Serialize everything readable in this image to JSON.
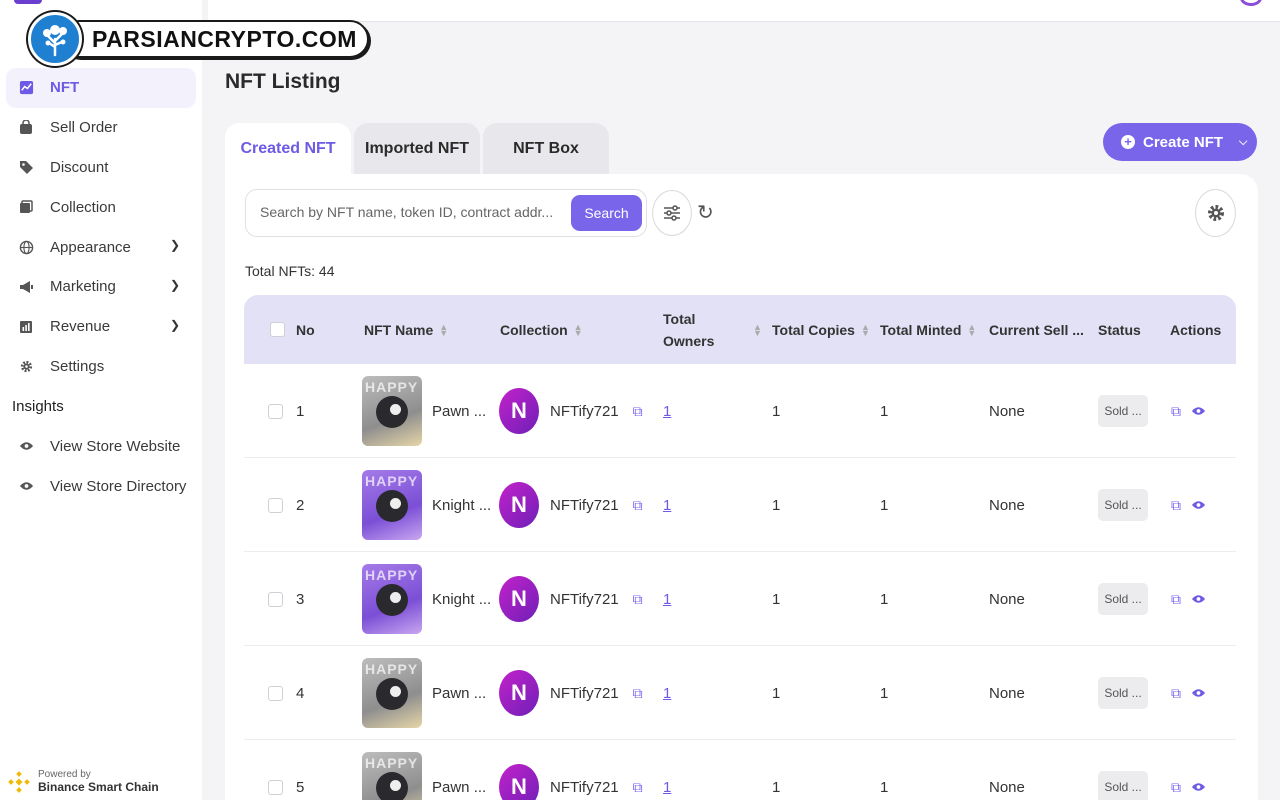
{
  "watermark": {
    "text": "PARSIANCRYPTO.COM"
  },
  "sidebar": {
    "items": [
      {
        "label": "NFT",
        "icon": "chart-line-icon",
        "active": true
      },
      {
        "label": "Sell Order",
        "icon": "bag-icon"
      },
      {
        "label": "Discount",
        "icon": "tag-icon"
      },
      {
        "label": "Collection",
        "icon": "collection-icon"
      },
      {
        "label": "Appearance",
        "icon": "globe-icon",
        "expandable": true
      },
      {
        "label": "Marketing",
        "icon": "megaphone-icon",
        "expandable": true
      },
      {
        "label": "Revenue",
        "icon": "bar-chart-icon",
        "expandable": true
      },
      {
        "label": "Settings",
        "icon": "gear-icon"
      }
    ],
    "section_title": "Insights",
    "insights": [
      {
        "label": "View Store Website",
        "icon": "eye-icon"
      },
      {
        "label": "View Store Directory",
        "icon": "eye-icon"
      }
    ],
    "powered_by": {
      "small": "Powered by",
      "big": "Binance Smart Chain"
    }
  },
  "page": {
    "title": "NFT Listing"
  },
  "tabs": [
    "Created NFT",
    "Imported NFT",
    "NFT Box"
  ],
  "create_button": {
    "label": "Create NFT"
  },
  "search": {
    "placeholder": "Search by NFT name, token ID, contract addr...",
    "button": "Search"
  },
  "total_label": "Total NFTs: 44",
  "table": {
    "headers": {
      "no": "No",
      "name": "NFT Name",
      "collection": "Collection",
      "owners_line1": "Total",
      "owners_line2": "Owners",
      "copies": "Total Copies",
      "minted": "Total Minted",
      "sell": "Current Sell ...",
      "status": "Status",
      "actions": "Actions"
    },
    "rows": [
      {
        "no": "1",
        "name": "Pawn ...",
        "thumb": "grey",
        "collection": "NFTify721",
        "owners": "1",
        "copies": "1",
        "minted": "1",
        "sell": "None",
        "status": "Sold ..."
      },
      {
        "no": "2",
        "name": "Knight ...",
        "thumb": "purple",
        "collection": "NFTify721",
        "owners": "1",
        "copies": "1",
        "minted": "1",
        "sell": "None",
        "status": "Sold ..."
      },
      {
        "no": "3",
        "name": "Knight ...",
        "thumb": "purple",
        "collection": "NFTify721",
        "owners": "1",
        "copies": "1",
        "minted": "1",
        "sell": "None",
        "status": "Sold ..."
      },
      {
        "no": "4",
        "name": "Pawn ...",
        "thumb": "grey",
        "collection": "NFTify721",
        "owners": "1",
        "copies": "1",
        "minted": "1",
        "sell": "None",
        "status": "Sold ..."
      },
      {
        "no": "5",
        "name": "Pawn ...",
        "thumb": "grey",
        "collection": "NFTify721",
        "owners": "1",
        "copies": "1",
        "minted": "1",
        "sell": "None",
        "status": "Sold ..."
      }
    ]
  },
  "colors": {
    "accent": "#7865ea",
    "header_bg": "#e2e1f5",
    "collection_logo": "#c222c9"
  }
}
